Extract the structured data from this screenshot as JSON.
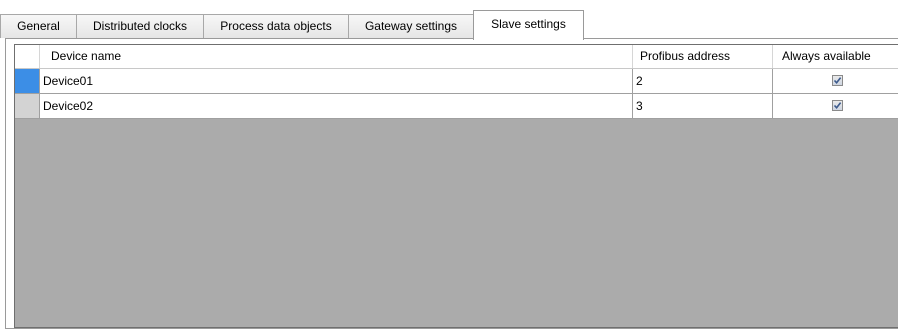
{
  "tabs": [
    {
      "label": "General",
      "active": false
    },
    {
      "label": "Distributed clocks",
      "active": false
    },
    {
      "label": "Process data objects",
      "active": false
    },
    {
      "label": "Gateway settings",
      "active": false
    },
    {
      "label": "Slave settings",
      "active": true
    }
  ],
  "grid": {
    "columns": {
      "name": "Device name",
      "address": "Profibus address",
      "available": "Always available"
    },
    "rows": [
      {
        "name": "Device01",
        "address": "2",
        "available": true,
        "selected": true
      },
      {
        "name": "Device02",
        "address": "3",
        "available": true,
        "selected": false
      }
    ]
  },
  "colors": {
    "row_selector_active": "#3c8ee6",
    "row_selector_inactive": "#d3d3d3",
    "grid_background": "#ababab",
    "checkmark": "#3c5a8c"
  },
  "icons": {
    "checkbox": "checkbox-checked-icon"
  }
}
